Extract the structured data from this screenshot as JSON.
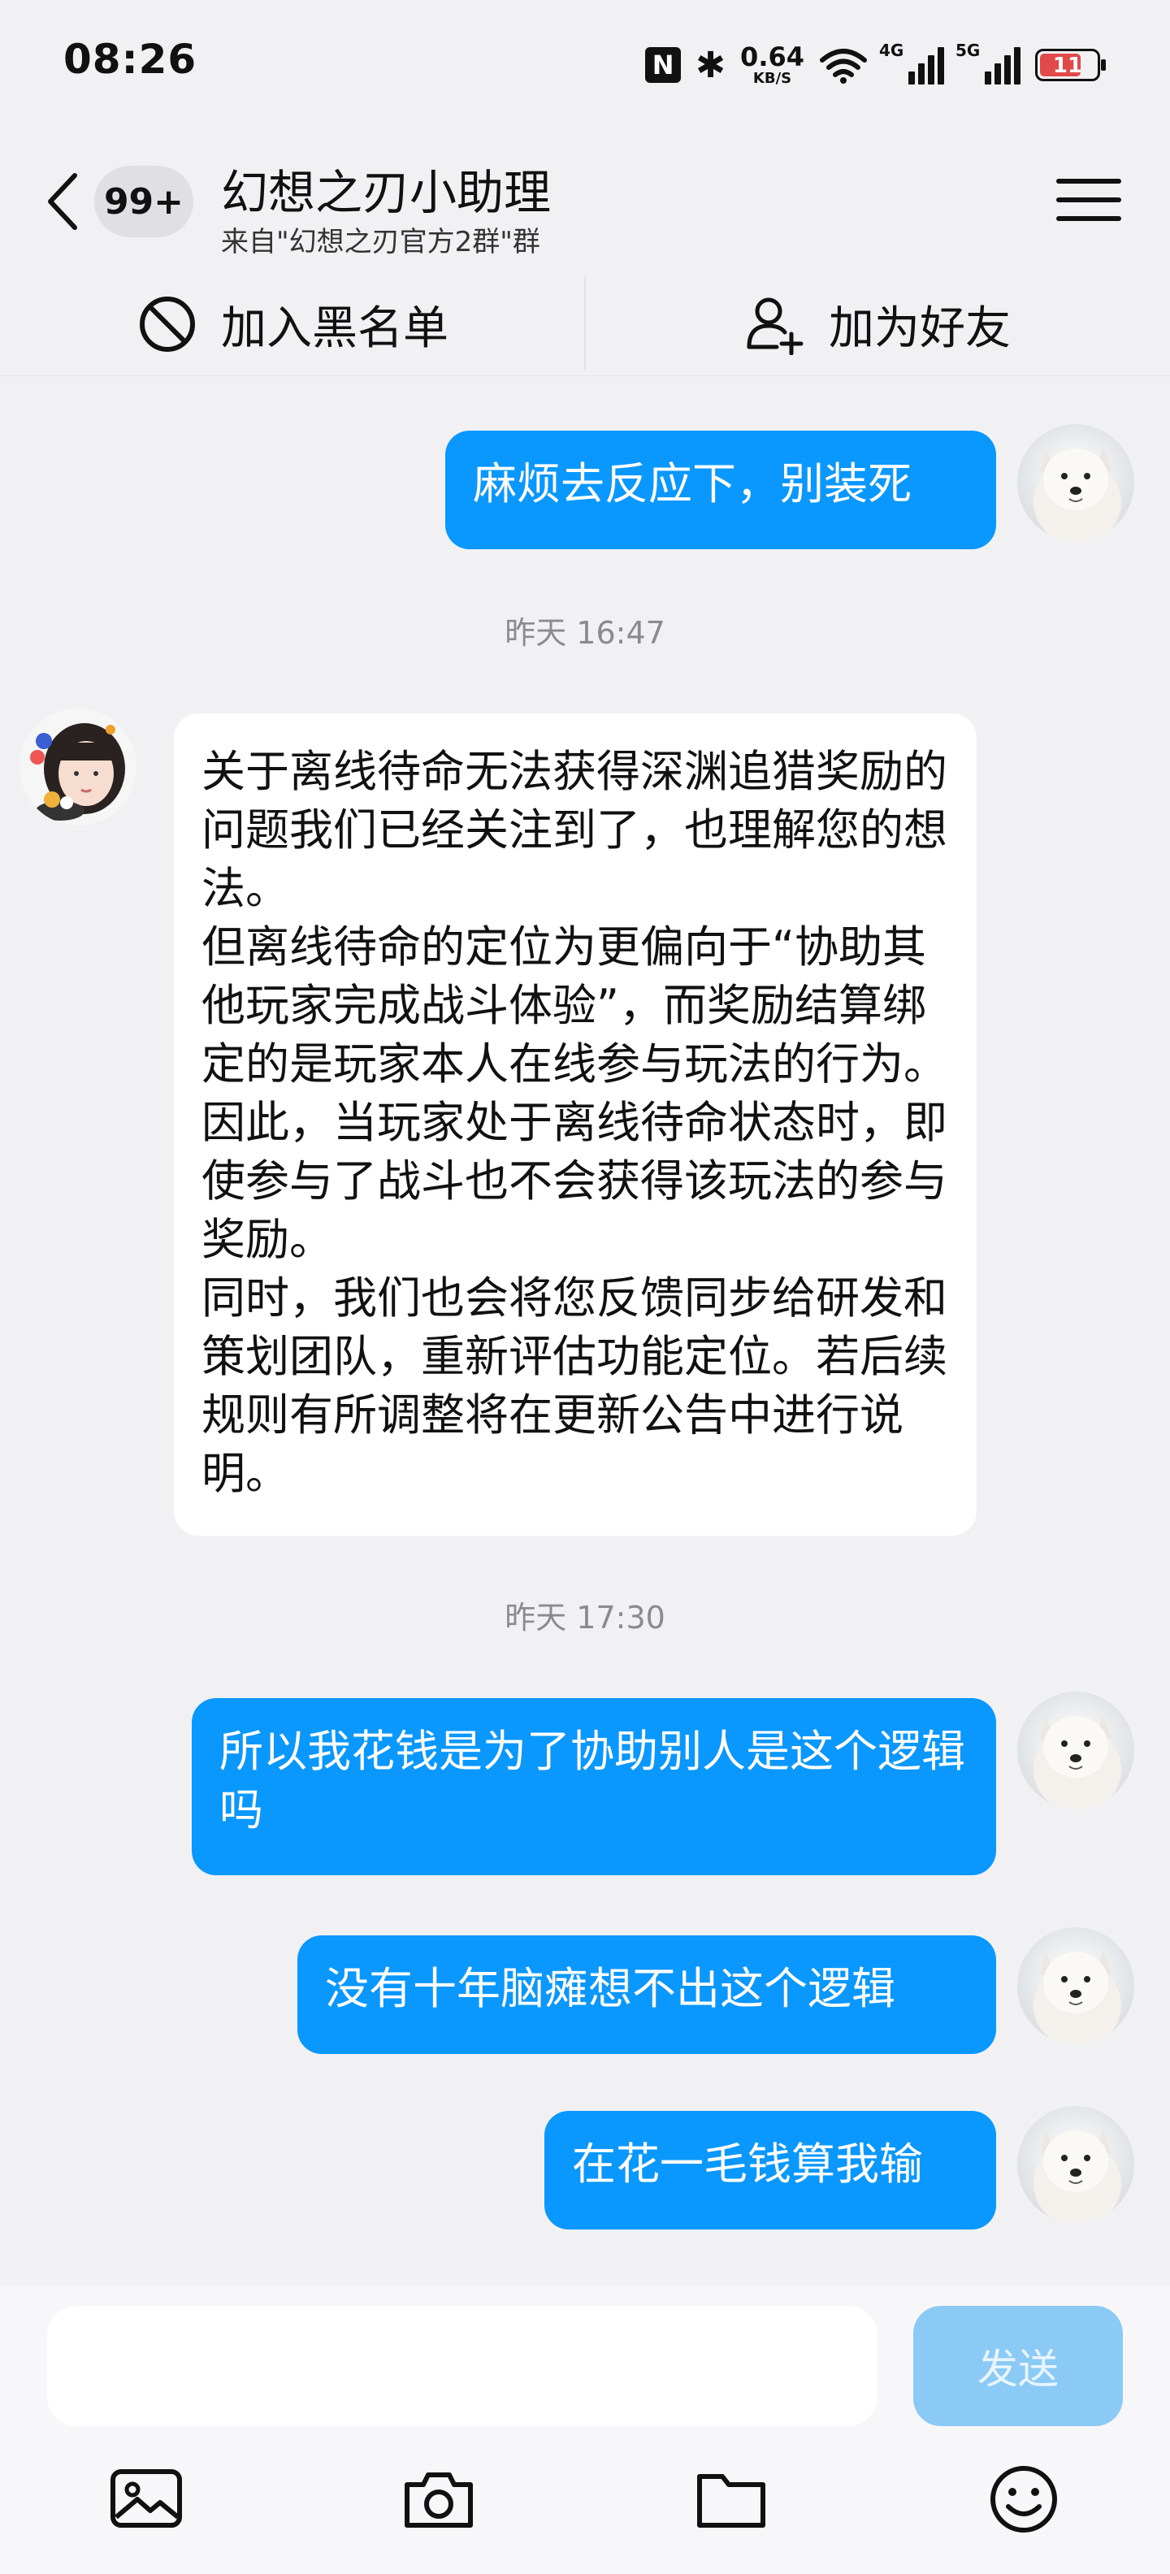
{
  "status": {
    "time": "08:26",
    "net_speed": "0.64",
    "net_unit": "KB/S",
    "sig1_label": "4G",
    "sig2_label": "5G",
    "battery": "11",
    "battery_color": "#e04a4a"
  },
  "header": {
    "unread_badge": "99+",
    "title": "幻想之刃小助理",
    "subtitle": "来自\"幻想之刃官方2群\"群"
  },
  "actions": {
    "block_label": "加入黑名单",
    "add_friend_label": "加为好友"
  },
  "messages": [
    {
      "text": "麻烦去反应下，别装死"
    },
    {
      "time": "昨天 16:47"
    },
    {
      "text": "关于离线待命无法获得深渊追猎奖励的问题我们已经关注到了，也理解您的想法。\n但离线待命的定位为更偏向于“协助其他玩家完成战斗体验”，而奖励结算绑定的是玩家本人在线参与玩法的行为。因此，当玩家处于离线待命状态时，即使参与了战斗也不会获得该玩法的参与奖励。\n同时，我们也会将您反馈同步给研发和策划团队，重新评估功能定位。若后续规则有所调整将在更新公告中进行说明。"
    },
    {
      "time": "昨天 17:30"
    },
    {
      "text": "所以我花钱是为了协助别人是这个逻辑吗"
    },
    {
      "text": "没有十年脑瘫想不出这个逻辑"
    },
    {
      "text": "在花一毛钱算我输"
    }
  ],
  "composer": {
    "input_value": "",
    "send_label": "发送"
  },
  "toolbar": [
    "image-icon",
    "camera-icon",
    "folder-icon",
    "emoji-icon"
  ],
  "colors": {
    "accent": "#0a98ff",
    "send_disabled": "#8ccaf6",
    "background": "#f1f1f3"
  }
}
